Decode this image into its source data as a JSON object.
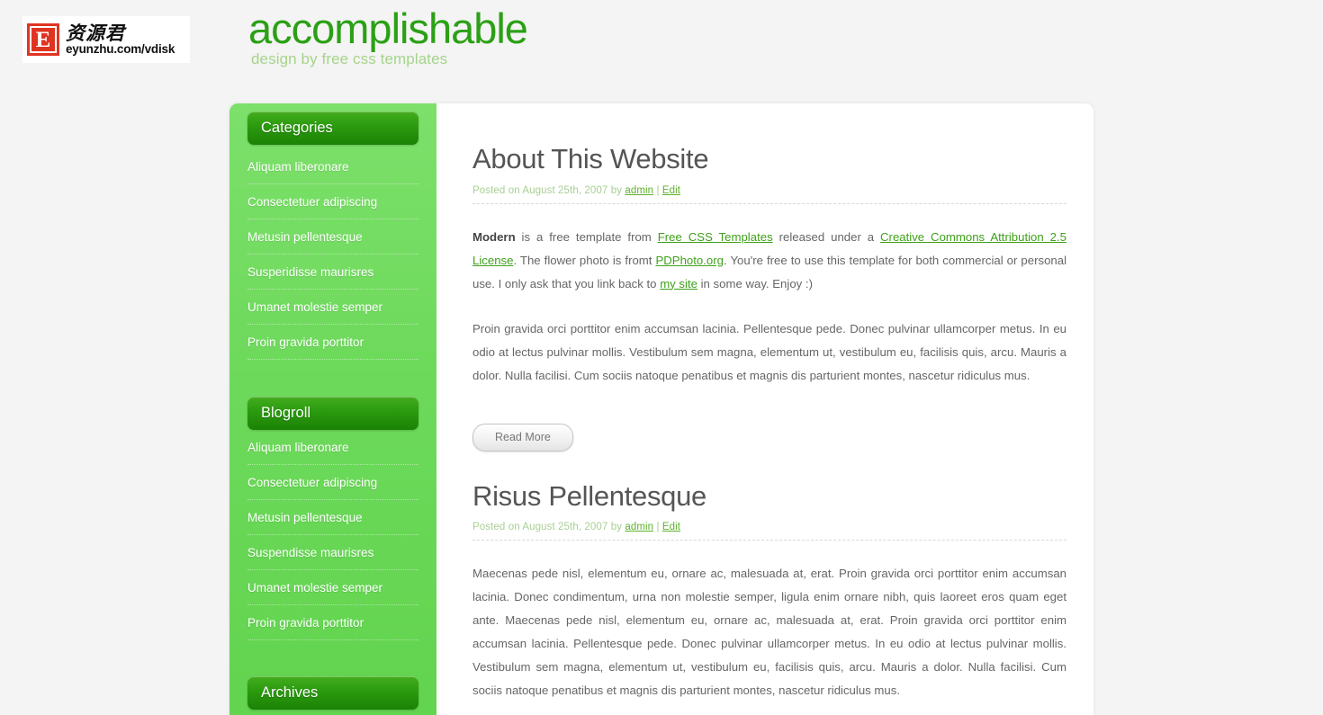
{
  "header": {
    "logo": {
      "mark_letter": "E",
      "chinese_text": "资源君",
      "url_text": "eyunzhu.com/vdisk"
    },
    "site_title": "accomplishable",
    "tagline": "design by free css templates",
    "title_color": "#2ba015",
    "tagline_color": "#a6d48b"
  },
  "sidebar": {
    "widgets": [
      {
        "title": "Categories",
        "items": [
          "Aliquam liberonare",
          "Consectetuer adipiscing",
          "Metusin pellentesque",
          "Susperidisse maurisres",
          "Umanet molestie semper",
          "Proin gravida porttitor"
        ]
      },
      {
        "title": "Blogroll",
        "items": [
          "Aliquam liberonare",
          "Consectetuer adipiscing",
          "Metusin pellentesque",
          "Suspendisse maurisres",
          "Umanet molestie semper",
          "Proin gravida porttitor"
        ]
      },
      {
        "title": "Archives",
        "items": []
      }
    ]
  },
  "main": {
    "posts": [
      {
        "title": "About This Website",
        "meta_prefix": "Posted on August 25th, 2007 by ",
        "meta_author": "admin",
        "meta_separator": " | ",
        "meta_edit": "Edit",
        "paragraph1": {
          "bold_lead": "Modern",
          "t1": " is a free template from ",
          "link1": "Free CSS Templates",
          "t2": " released under a ",
          "link2": "Creative Commons Attribution 2.5 License",
          "t3": ". The flower photo is fromt ",
          "link3": "PDPhoto.org",
          "t4": ". You're free to use this template for both commercial or personal use. I only ask that you link back to ",
          "link4": "my site",
          "t5": " in some way. Enjoy :)"
        },
        "paragraph2": "Proin gravida orci porttitor enim accumsan lacinia. Pellentesque pede. Donec pulvinar ullamcorper metus. In eu odio at lectus pulvinar mollis. Vestibulum sem magna, elementum ut, vestibulum eu, facilisis quis, arcu. Mauris a dolor. Nulla facilisi. Cum sociis natoque penatibus et magnis dis parturient montes, nascetur ridiculus mus.",
        "read_more_label": "Read More"
      },
      {
        "title": "Risus Pellentesque",
        "meta_prefix": "Posted on August 25th, 2007 by ",
        "meta_author": "admin",
        "meta_separator": " | ",
        "meta_edit": "Edit",
        "paragraph1": "Maecenas pede nisl, elementum eu, ornare ac, malesuada at, erat. Proin gravida orci porttitor enim accumsan lacinia. Donec condimentum, urna non molestie semper, ligula enim ornare nibh, quis laoreet eros quam eget ante. Maecenas pede nisl, elementum eu, ornare ac, malesuada at, erat. Proin gravida orci porttitor enim accumsan lacinia. Pellentesque pede. Donec pulvinar ullamcorper metus. In eu odio at lectus pulvinar mollis. Vestibulum sem magna, elementum ut, vestibulum eu, facilisis quis, arcu. Mauris a dolor. Nulla facilisi. Cum sociis natoque penatibus et magnis dis parturient montes, nascetur ridiculus mus."
      }
    ]
  },
  "colors": {
    "page_background": "#f4f4f4",
    "sidebar_green": "#6dd95b",
    "widget_header_green": "#2d9c10",
    "link_green": "#3fa11a"
  }
}
